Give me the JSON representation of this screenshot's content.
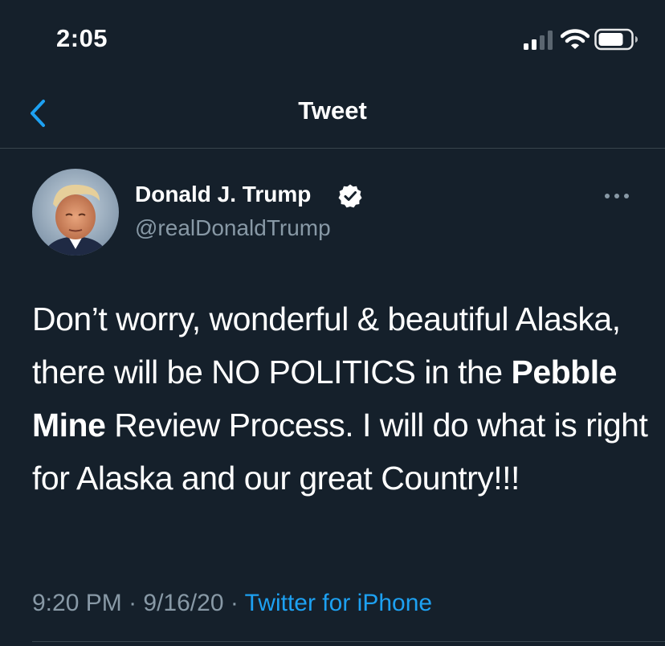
{
  "status_bar": {
    "time": "2:05"
  },
  "nav": {
    "title": "Tweet"
  },
  "author": {
    "name": "Donald J. Trump",
    "handle": "@realDonaldTrump",
    "verified": true
  },
  "tweet": {
    "text_part1": "Don’t worry, wonderful & beautiful Alaska, there will be NO POLITICS in the ",
    "text_bold": "Pebble Mine",
    "text_part2": " Review Process. I will do what is right for Alaska and our great Country!!!",
    "time": "9:20 PM",
    "separator": " · ",
    "date": "9/16/20",
    "source": "Twitter for iPhone"
  },
  "colors": {
    "background": "#15202b",
    "accent": "#1da1f2",
    "secondary_text": "#8899a6",
    "divider": "#38444d"
  },
  "icons": {
    "back": "chevron-left-icon",
    "verified": "verified-badge-icon",
    "more": "more-horizontal-icon",
    "signal": "cellular-signal-icon",
    "wifi": "wifi-icon",
    "battery": "battery-icon"
  }
}
